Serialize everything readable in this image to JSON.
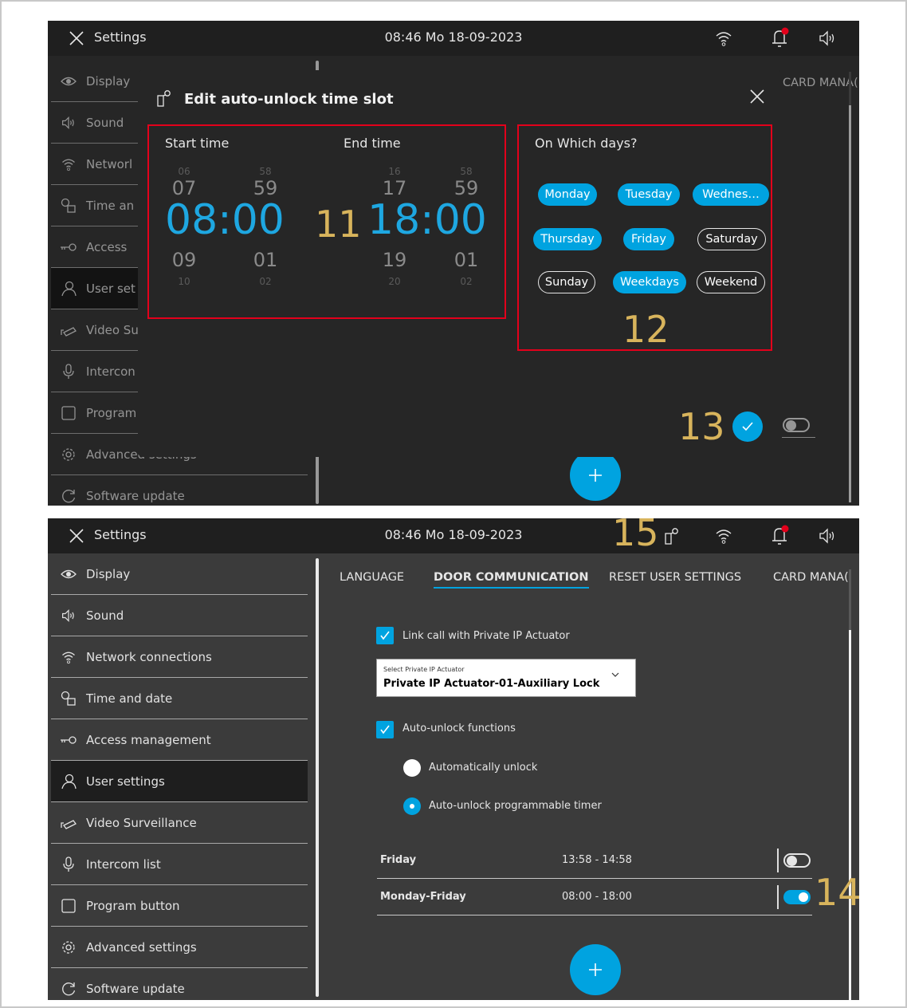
{
  "callouts": {
    "c11": "11",
    "c12": "12",
    "c13": "13",
    "c14": "14",
    "c15": "15"
  },
  "topbar": {
    "title": "Settings",
    "clock": "08:46  Mo 18-09-2023"
  },
  "sidebar": {
    "items": [
      {
        "label": "Display",
        "icon": "eye-icon"
      },
      {
        "label": "Sound",
        "icon": "speaker-icon"
      },
      {
        "label": "Network connections",
        "icon": "wifi-icon"
      },
      {
        "label": "Time and date",
        "icon": "clock-calendar-icon"
      },
      {
        "label": "Access  management",
        "icon": "key-icon"
      },
      {
        "label": "User settings",
        "icon": "user-icon"
      },
      {
        "label": "Video Surveillance",
        "icon": "camera-icon"
      },
      {
        "label": "Intercom list",
        "icon": "microphone-icon"
      },
      {
        "label": "Program button",
        "icon": "square-icon"
      },
      {
        "label": "Advanced settings",
        "icon": "gear-icon"
      },
      {
        "label": "Software update",
        "icon": "refresh-icon"
      }
    ],
    "items_top_truncated": [
      "Display",
      "Sound",
      "Networl",
      "Time an",
      "Access",
      "User set",
      "Video Su",
      "Intercon",
      "Program",
      "Advanced settings",
      "Software update"
    ]
  },
  "tabs": {
    "language": "LANGUAGE",
    "door": "DOOR COMMUNICATION",
    "reset": "RESET USER SETTINGS",
    "card": "CARD MANA("
  },
  "door": {
    "link_label": "Link call with Private  IP Actuator",
    "select_caption": "Select Private IP Actuator",
    "select_value": "Private IP Actuator-01-Auxiliary Lock",
    "auto_label": "Auto-unlock functions",
    "radio_auto": "Automatically unlock",
    "radio_timer": "Auto-unlock programmable timer",
    "slots": [
      {
        "day": "Friday",
        "time": "13:58 - 14:58",
        "enabled": false
      },
      {
        "day": "Monday-Friday",
        "time": "08:00 - 18:00",
        "enabled": true
      }
    ]
  },
  "dialog": {
    "title": "Edit auto-unlock time slot",
    "start_label": "Start time",
    "end_label": "End time",
    "days_label": "On Which days?",
    "start": {
      "h_prev2": "06",
      "h_prev": "07",
      "h": "08",
      "h_next": "09",
      "h_next2": "10",
      "m_prev2": "58",
      "m_prev": "59",
      "m": "00",
      "m_next": "01",
      "m_next2": "02"
    },
    "end": {
      "h_prev2": "16",
      "h_prev": "17",
      "h": "18",
      "h_next": "19",
      "h_next2": "20",
      "m_prev2": "58",
      "m_prev": "59",
      "m": "00",
      "m_next": "01",
      "m_next2": "02"
    },
    "colon": ":",
    "days": [
      {
        "label": "Monday",
        "selected": true
      },
      {
        "label": "Tuesday",
        "selected": true
      },
      {
        "label": "Wednes…",
        "selected": true
      },
      {
        "label": "Thursday",
        "selected": true
      },
      {
        "label": "Friday",
        "selected": true
      },
      {
        "label": "Saturday",
        "selected": false
      },
      {
        "label": "Sunday",
        "selected": false
      },
      {
        "label": "Weekdays",
        "selected": true
      },
      {
        "label": "Weekend",
        "selected": false
      }
    ]
  },
  "colors": {
    "accent": "#00a3e0",
    "callout": "#d8b45c",
    "highlight": "#e3001b",
    "bg": "#3b3b3b",
    "topbar": "#1f1f1f"
  }
}
